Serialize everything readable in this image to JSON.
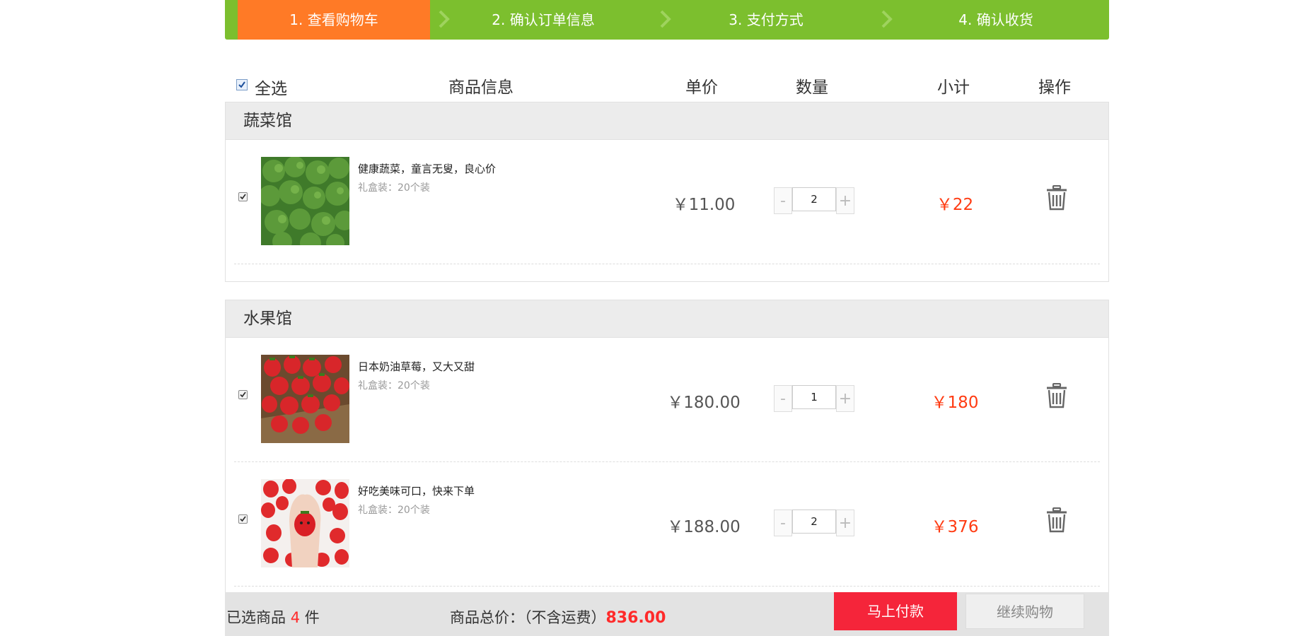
{
  "steps": [
    {
      "label": "1. 查看购物车"
    },
    {
      "label": "2. 确认订单信息"
    },
    {
      "label": "3. 支付方式"
    },
    {
      "label": "4. 确认收货"
    }
  ],
  "header": {
    "select_all": "全选",
    "product_info": "商品信息",
    "unit_price": "单价",
    "quantity": "数量",
    "subtotal": "小计",
    "operation": "操作"
  },
  "shops": [
    {
      "name": "蔬菜馆",
      "items": [
        {
          "title": "健康蔬菜，童言无叟，良心价",
          "spec": "礼盒装：20个装",
          "price": "￥11.00",
          "qty": "2",
          "subtotal": "￥22",
          "image_icon": "broccoli-image"
        }
      ]
    },
    {
      "name": "水果馆",
      "items": [
        {
          "title": "日本奶油草莓，又大又甜",
          "spec": "礼盒装：20个装",
          "price": "￥180.00",
          "qty": "1",
          "subtotal": "￥180",
          "image_icon": "strawberry-crate-image"
        },
        {
          "title": "好吃美味可口，快来下单",
          "spec": "礼盒装：20个装",
          "price": "￥188.00",
          "qty": "2",
          "subtotal": "￥376",
          "image_icon": "strawberry-hand-image"
        }
      ]
    }
  ],
  "qty_controls": {
    "minus": "-",
    "plus": "+"
  },
  "footer": {
    "selected_prefix": "已选商品",
    "selected_count": "4",
    "selected_suffix": "件",
    "total_label": "商品总价：（不含运费）",
    "total_value": "836.00",
    "pay_button": "马上付款",
    "continue_button": "继续购物"
  },
  "colors": {
    "step_active": "#ff7a26",
    "step_bar": "#7cbf2e",
    "price_red": "#ff3b12",
    "pay_red": "#f5253a"
  }
}
